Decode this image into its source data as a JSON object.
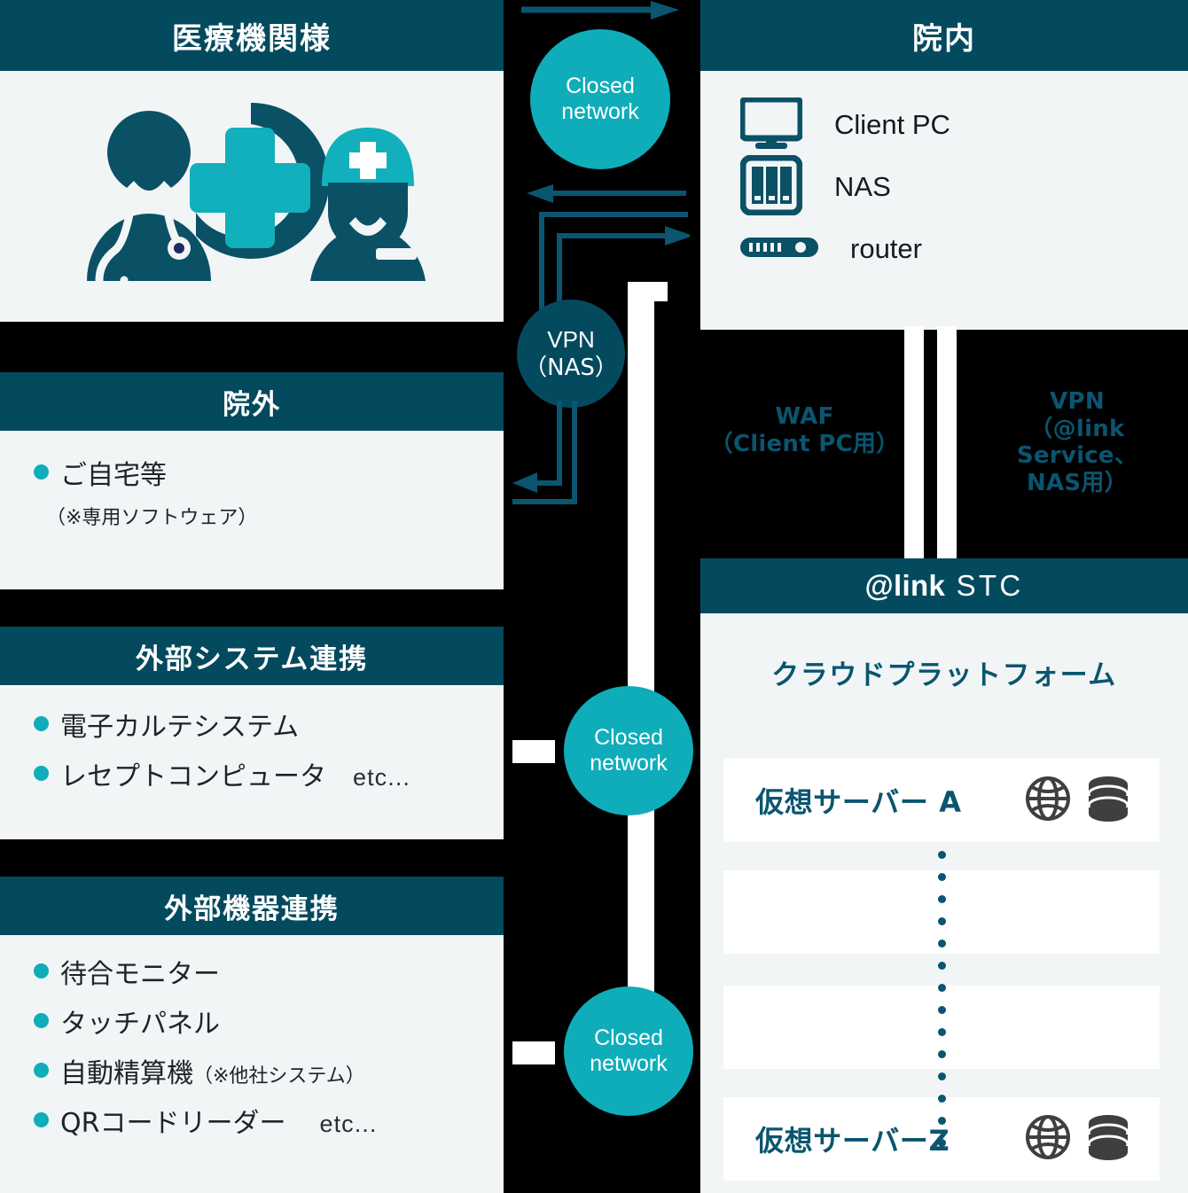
{
  "colors": {
    "navy": "#044a5e",
    "teal": "#0fadba",
    "panel_bg": "#f2f5f6",
    "background": "#000000",
    "line": "#0a5570",
    "white": "#ffffff"
  },
  "left_column": {
    "medical": {
      "title": "医療機関様",
      "illustration": "doctor-nurse-medical-cross-illustration"
    },
    "outside": {
      "title": "院外",
      "items": [
        {
          "label": "ご自宅等",
          "note": "（※専用ソフトウェア）"
        }
      ]
    },
    "external_systems": {
      "title": "外部システム連携",
      "items": [
        {
          "label": "電子カルテシステム",
          "etc": ""
        },
        {
          "label": "レセプトコンピュータ",
          "etc": "etc..."
        }
      ]
    },
    "external_devices": {
      "title": "外部機器連携",
      "items": [
        {
          "label": "待合モニター",
          "note": "",
          "etc": ""
        },
        {
          "label": "タッチパネル",
          "note": "",
          "etc": ""
        },
        {
          "label": "自動精算機",
          "note": "（※他社システム）",
          "etc": ""
        },
        {
          "label": "QRコードリーダー",
          "note": "",
          "etc": "etc..."
        }
      ]
    }
  },
  "middle_column": {
    "nodes": [
      {
        "id": "closed-network-top",
        "label_line1": "Closed",
        "label_line2": "network",
        "style": "teal"
      },
      {
        "id": "vpn-nas",
        "label_line1": "VPN",
        "label_line2": "（NAS）",
        "style": "navy"
      },
      {
        "id": "closed-network-mid",
        "label_line1": "Closed",
        "label_line2": "network",
        "style": "teal"
      },
      {
        "id": "closed-network-bottom",
        "label_line1": "Closed",
        "label_line2": "network",
        "style": "teal"
      }
    ]
  },
  "right_column": {
    "innai": {
      "title": "院内",
      "devices": [
        {
          "icon": "monitor-icon",
          "label": "Client PC"
        },
        {
          "icon": "nas-icon",
          "label": "NAS"
        },
        {
          "icon": "router-icon",
          "label": "router"
        }
      ]
    },
    "connections": [
      {
        "id": "waf",
        "line1": "WAF",
        "line2": "（Client PC用）",
        "line3": ""
      },
      {
        "id": "vpn",
        "line1": "VPN",
        "line2": "（@link Service、",
        "line3": "NAS用）"
      }
    ],
    "stc": {
      "title_mark": "@link",
      "title_tail": " STC",
      "platform_title": "クラウドプラットフォーム",
      "servers": [
        {
          "name": "仮想サーバー A",
          "icons": [
            "globe-icon",
            "database-icon"
          ]
        },
        {
          "name": "",
          "icons": []
        },
        {
          "name": "",
          "icons": []
        },
        {
          "name": "仮想サーバーZ",
          "icons": [
            "globe-icon",
            "database-icon"
          ]
        }
      ]
    }
  }
}
